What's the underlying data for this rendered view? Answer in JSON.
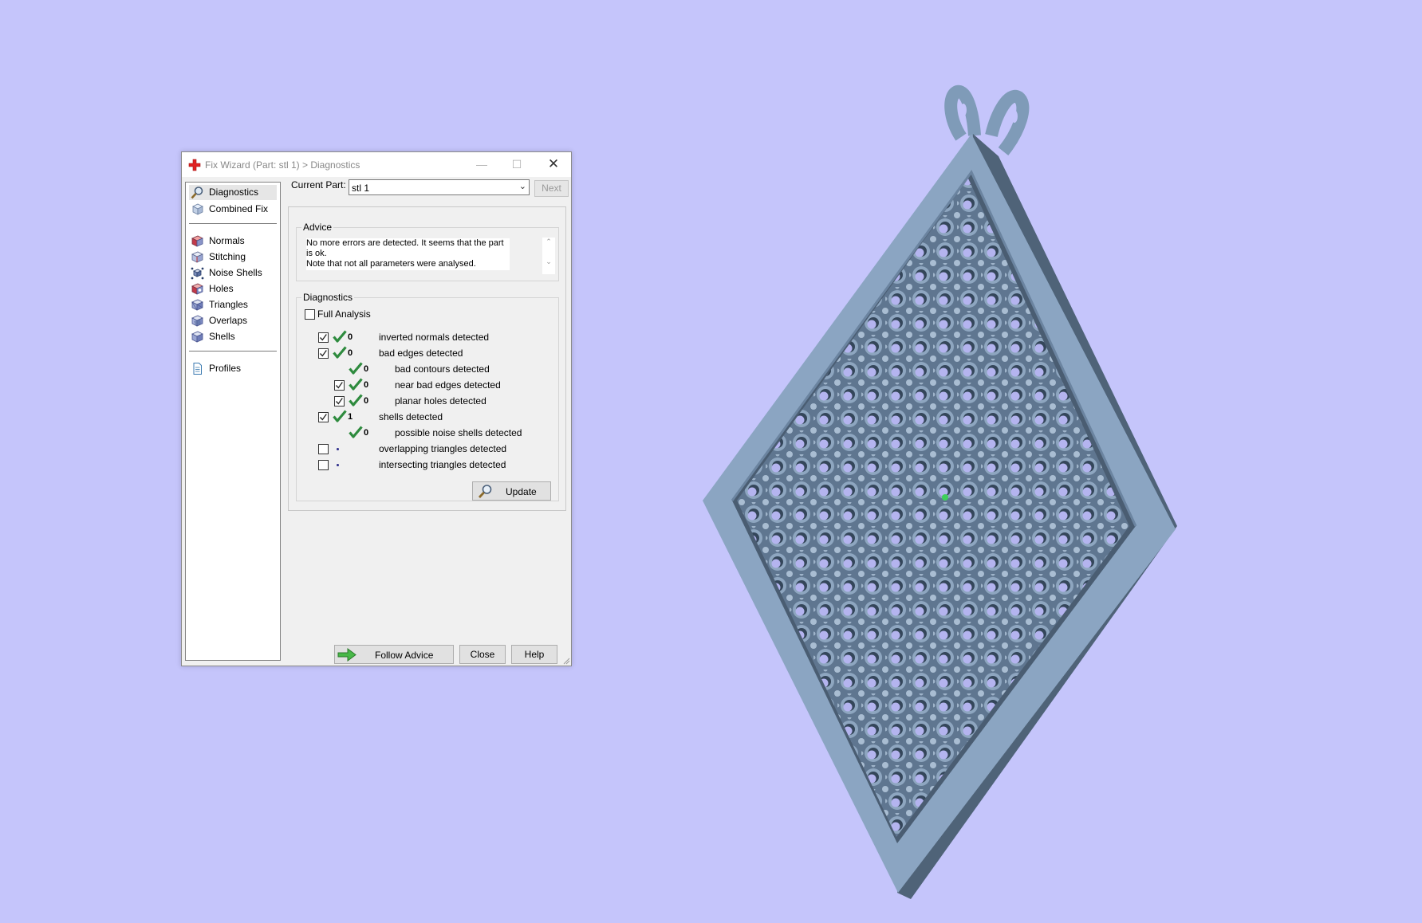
{
  "window": {
    "title": "Fix Wizard (Part: stl 1) > Diagnostics",
    "icon": "red-cross-icon",
    "controls": {
      "minimize": "—",
      "maximize": "☐",
      "close": "✕"
    }
  },
  "nav": {
    "top": [
      {
        "label": "Diagnostics",
        "icon": "magnifier-icon",
        "selected": true
      },
      {
        "label": "Combined Fix",
        "icon": "cube-icon"
      }
    ],
    "tools": [
      {
        "label": "Normals",
        "icon": "normals-cube-icon"
      },
      {
        "label": "Stitching",
        "icon": "stitching-cube-icon"
      },
      {
        "label": "Noise Shells",
        "icon": "noise-shells-icon"
      },
      {
        "label": "Holes",
        "icon": "holes-cube-icon"
      },
      {
        "label": "Triangles",
        "icon": "triangles-cube-icon"
      },
      {
        "label": "Overlaps",
        "icon": "overlaps-cube-icon"
      },
      {
        "label": "Shells",
        "icon": "shells-cube-icon"
      }
    ],
    "bottom": [
      {
        "label": "Profiles",
        "icon": "document-icon"
      }
    ]
  },
  "current_part": {
    "label": "Current Part:",
    "value": "stl 1",
    "next_label": "Next"
  },
  "advice": {
    "title": "Advice",
    "line1": "No more errors are detected. It seems that the part is ok.",
    "line2": "Note that not all parameters were analysed."
  },
  "diagnostics": {
    "title": "Diagnostics",
    "full_analysis_label": "Full Analysis",
    "full_analysis_checked": false,
    "rows": [
      {
        "checked": true,
        "status": "ok",
        "count": "0",
        "label": "inverted normals detected"
      },
      {
        "checked": true,
        "status": "ok",
        "count": "0",
        "label": "bad edges detected"
      },
      {
        "checked": null,
        "status": "ok",
        "count": "0",
        "label": "bad contours detected"
      },
      {
        "checked": true,
        "status": "ok",
        "count": "0",
        "label": "near bad edges detected"
      },
      {
        "checked": true,
        "status": "ok",
        "count": "0",
        "label": "planar holes detected"
      },
      {
        "checked": true,
        "status": "ok",
        "count": "1",
        "label": "shells detected"
      },
      {
        "checked": null,
        "status": "ok",
        "count": "0",
        "label": "possible noise shells detected"
      },
      {
        "checked": false,
        "status": "pending",
        "count": "",
        "label": "overlapping triangles detected"
      },
      {
        "checked": false,
        "status": "pending",
        "count": "",
        "label": "intersecting triangles detected"
      }
    ],
    "update_label": "Update"
  },
  "footer": {
    "follow_advice_label": "Follow Advice",
    "close_label": "Close",
    "help_label": "Help"
  },
  "colors": {
    "background": "#c5c5fb",
    "model": "#7f9bb8",
    "ok_tick": "#2e8b3e",
    "title_icon": "#e02020"
  }
}
